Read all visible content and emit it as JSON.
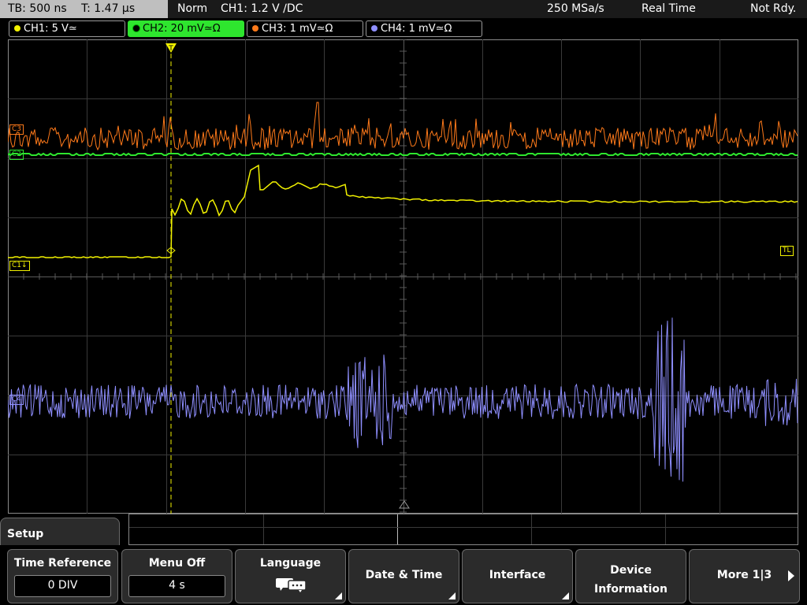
{
  "status": {
    "timebase": "TB: 500 ns",
    "trigger_time": "T: 1.47 µs",
    "mode": "Norm",
    "trigger_setting": "CH1: 1.2 V ∕DC",
    "sample_rate": "250 MSa/s",
    "acq_mode": "Real Time",
    "state": "Not Rdy."
  },
  "channels": [
    {
      "label": "CH1: 5 V≃",
      "color": "#f2f200"
    },
    {
      "label": "CH2: 20 mV≃Ω",
      "color": "#2ee52e"
    },
    {
      "label": "CH3: 1 mV≃Ω",
      "color": "#ff7a1a"
    },
    {
      "label": "CH4: 1 mV≃Ω",
      "color": "#8f8fff"
    }
  ],
  "markers": {
    "ch3": "C3",
    "ch2": "C2",
    "ch1": "C1↓",
    "trigger_level": "TL",
    "ch4": "C4"
  },
  "menu": {
    "title": "Setup",
    "keys": [
      {
        "label": "Time Reference",
        "value": "0 DIV"
      },
      {
        "label": "Menu Off",
        "value": "4 s"
      },
      {
        "label": "Language"
      },
      {
        "label": "Date & Time"
      },
      {
        "label": "Interface"
      },
      {
        "label": "Device",
        "label2": "Information"
      },
      {
        "label": "More 1|3"
      }
    ]
  },
  "icons": {
    "language": "speech-bubbles-icon",
    "more": "arrow-right-icon",
    "submenu": "corner-triangle-icon",
    "trigger": "trigger-position-icon"
  }
}
